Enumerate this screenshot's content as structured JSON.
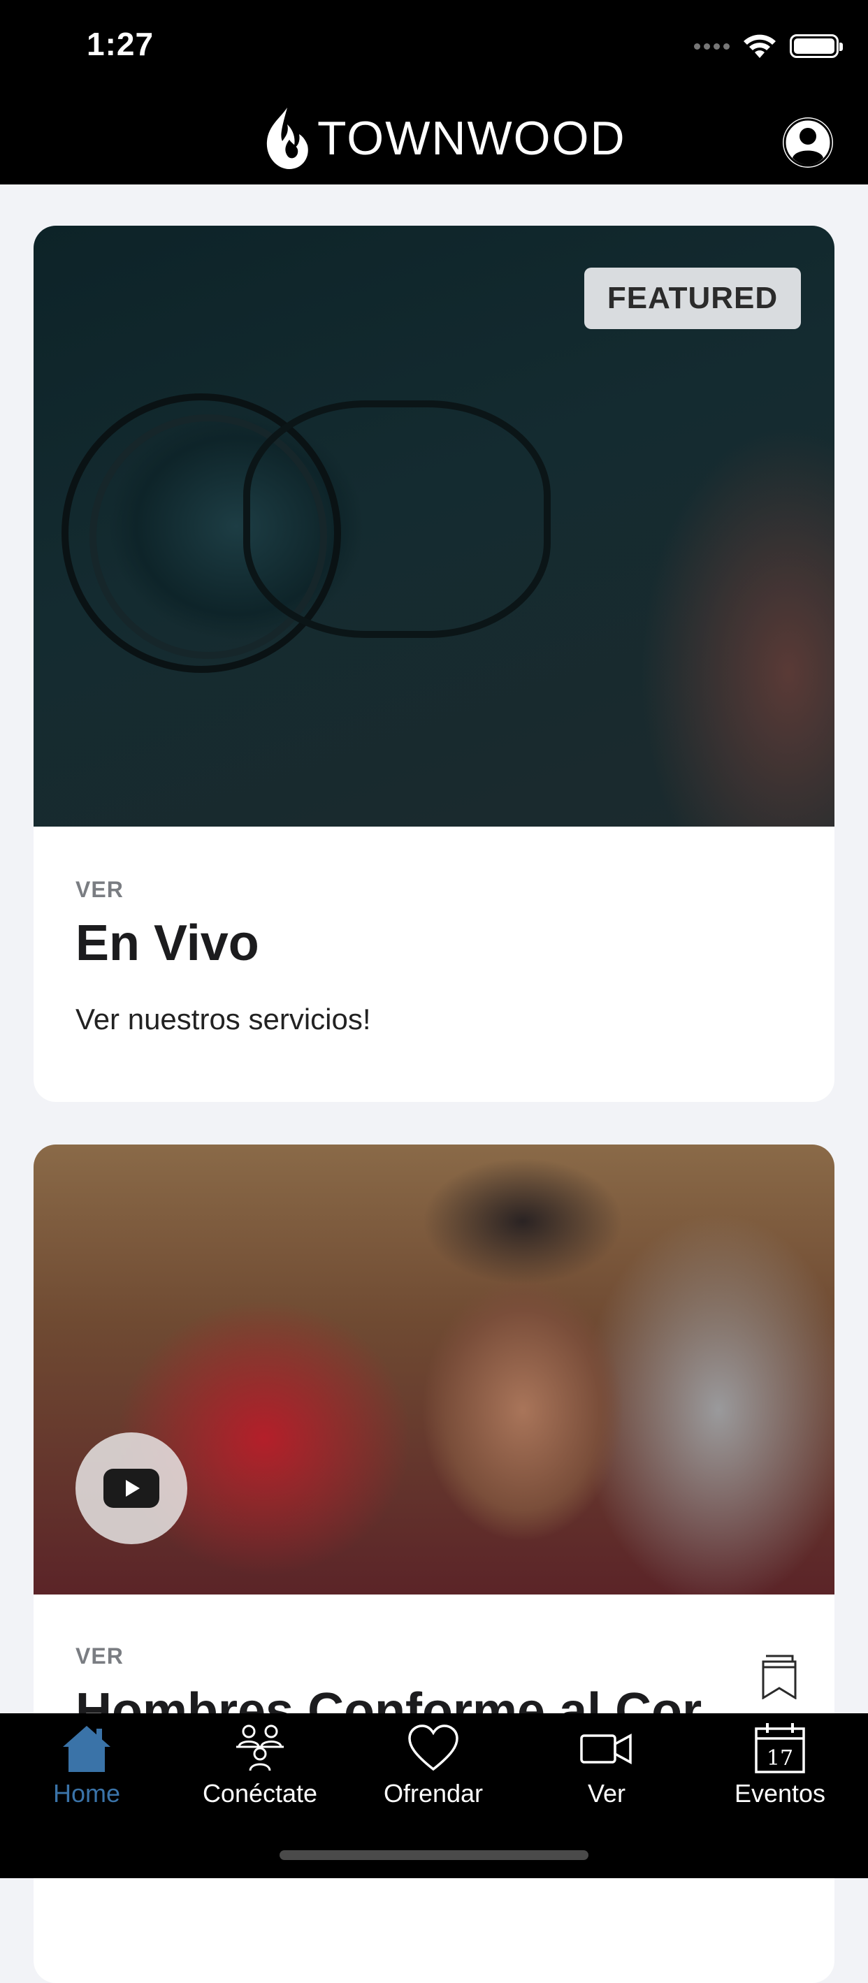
{
  "status_bar": {
    "time": "1:27"
  },
  "header": {
    "logo_text": "TOWNWOOD"
  },
  "featured_card": {
    "badge": "FEATURED",
    "eyebrow": "VER",
    "title": "En Vivo",
    "description": "Ver nuestros servicios!"
  },
  "second_card": {
    "eyebrow": "VER",
    "title": "Hombres Conforme al Cor"
  },
  "tabbar": {
    "active_color": "#3a73a8",
    "tabs": [
      {
        "label": "Home",
        "icon": "home-icon",
        "active": true
      },
      {
        "label": "Conéctate",
        "icon": "people-icon",
        "active": false
      },
      {
        "label": "Ofrendar",
        "icon": "heart-icon",
        "active": false
      },
      {
        "label": "Ver",
        "icon": "video-camera-icon",
        "active": false
      },
      {
        "label": "Eventos",
        "icon": "calendar-icon",
        "active": false,
        "badge_text": "17"
      }
    ]
  }
}
